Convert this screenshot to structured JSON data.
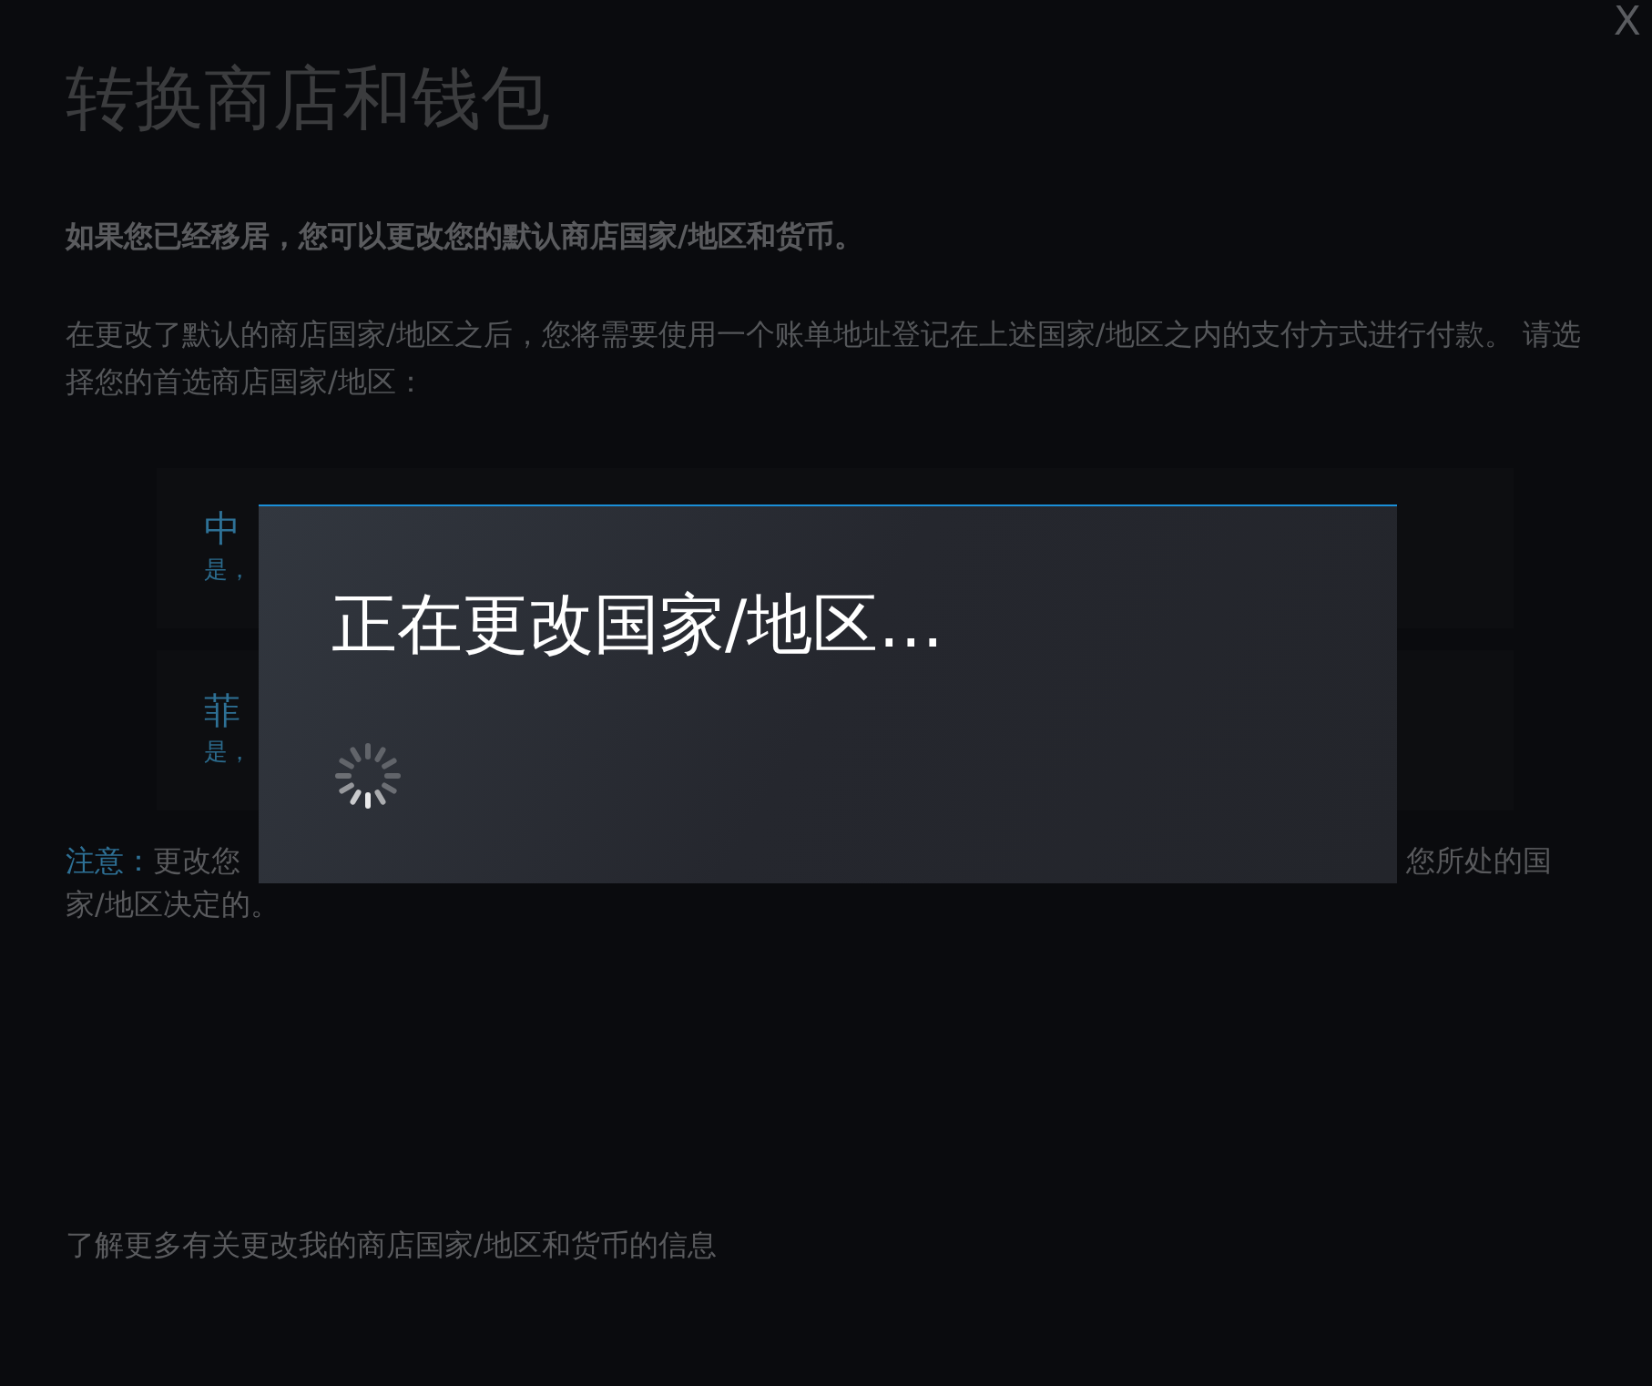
{
  "title": "转换商店和钱包",
  "close": "X",
  "intro": "如果您已经移居，您可以更改您的默认商店国家/地区和货币。",
  "instructions": "在更改了默认的商店国家/地区之后，您将需要使用一个账单地址登记在上述国家/地区之内的支付方式进行付款。 请选择您的首选商店国家/地区：",
  "countries": [
    {
      "name": "中",
      "subtitle": "是，"
    },
    {
      "name": "菲",
      "subtitle": "是，"
    }
  ],
  "note": {
    "label": "注意：",
    "text_left": "更改您",
    "text_right": "您所处的国",
    "text_line2": "家/地区决定的。"
  },
  "learn_more": "了解更多有关更改我的商店国家/地区和货币的信息",
  "modal": {
    "title": "正在更改国家/地区…",
    "loading": true
  }
}
